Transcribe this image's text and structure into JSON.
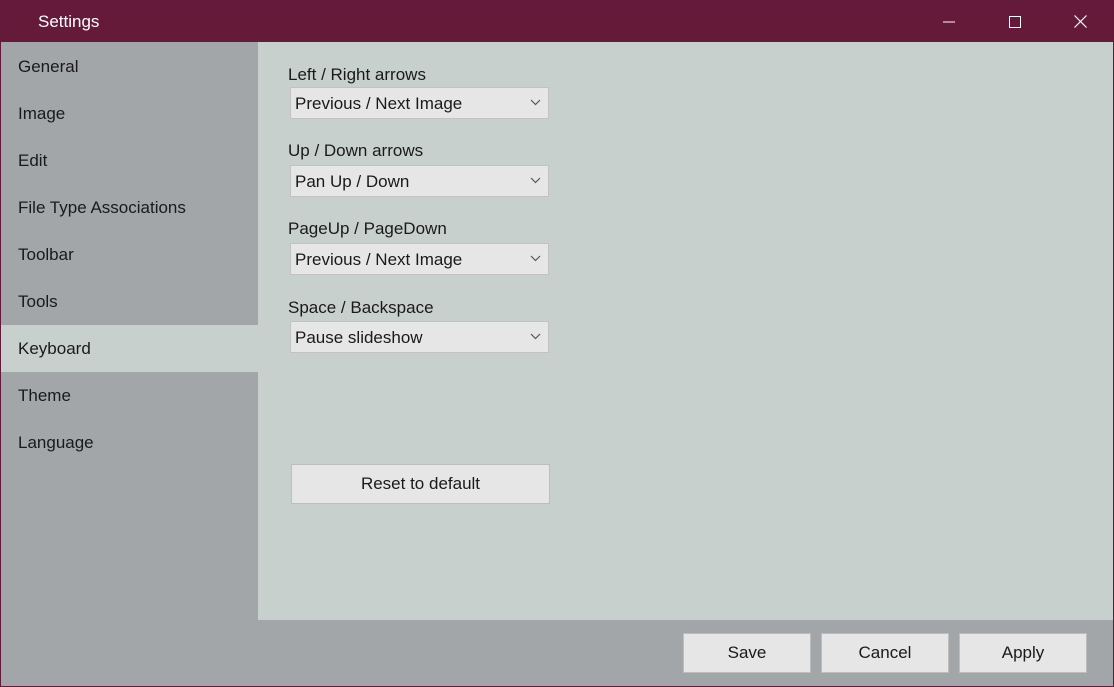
{
  "window": {
    "title": "Settings",
    "colors": {
      "titlebar": "#661a3a",
      "sidebar": "#a2a6a8",
      "content": "#c8d0ce",
      "control": "#e6e6e6"
    }
  },
  "titlebar_buttons": {
    "minimize_icon": "minimize-icon",
    "maximize_icon": "maximize-icon",
    "close_icon": "close-icon"
  },
  "sidebar": {
    "items": [
      {
        "label": "General"
      },
      {
        "label": "Image"
      },
      {
        "label": "Edit"
      },
      {
        "label": "File Type Associations"
      },
      {
        "label": "Toolbar"
      },
      {
        "label": "Tools"
      },
      {
        "label": "Keyboard",
        "selected": true
      },
      {
        "label": "Theme"
      },
      {
        "label": "Language"
      }
    ]
  },
  "keyboard": {
    "fields": [
      {
        "label": "Left / Right arrows",
        "value": "Previous / Next Image"
      },
      {
        "label": "Up / Down arrows",
        "value": "Pan Up / Down"
      },
      {
        "label": "PageUp / PageDown",
        "value": "Previous / Next Image"
      },
      {
        "label": "Space / Backspace",
        "value": "Pause slideshow"
      }
    ],
    "reset_label": "Reset to default"
  },
  "footer": {
    "save_label": "Save",
    "cancel_label": "Cancel",
    "apply_label": "Apply"
  }
}
